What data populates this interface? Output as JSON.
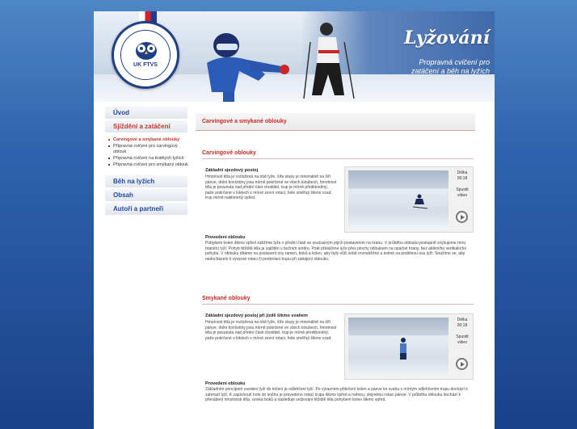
{
  "header": {
    "title": "Lyžování",
    "subtitle_line1": "Propravná cvičení pro",
    "subtitle_line2": "zatáčení a běh na lyžích",
    "logo_text": "UK FTVS"
  },
  "sidebar": {
    "items": [
      {
        "label": "Úvod"
      },
      {
        "label": "Sjíždění a zatáčení"
      },
      {
        "label": "Běh na lyžích"
      },
      {
        "label": "Obsah"
      },
      {
        "label": "Autoři a partneři"
      }
    ],
    "subitems": [
      {
        "label": "Carvingové a smykané oblouky"
      },
      {
        "label": "Přípravná cvičení pro carvingový oblouk"
      },
      {
        "label": "Přípravná cvičení na krátkých lyžích"
      },
      {
        "label": "Přípravná cvičení pro smýkaný oblouk"
      }
    ]
  },
  "main": {
    "heading": "Carvingové a smykané oblouky",
    "sections": [
      {
        "title": "Carvingové oblouky",
        "block1_title": "Základní sjezdový postoj",
        "block1_text": "Hmotnost těla je rozložená na obě lyže, šíře stopy je minimálně na šíři pánve, dolní končetiny jsou mírně pokrčené ve všech kloubech, hmotnost těla je posunuta nad přední část chodidel, trup je mírně předkloněný, paže pokrčené v loktech v mírné zevní rotaci, hole směřují šikmo vzad, trup mírně naklonený vpřed.",
        "block2_title": "Provedení oblouku",
        "block2_text": "Pohybem kolen šikmo vpřed zatížíme lyže v přední části se současným jejich postavením na hranu. V průběhu oblouku postupně zvyšujeme míru hranění lyží. Pohyb těžiště těla je zajištěn v bočním směru. Poté přetáčíme lyže přes plochy obloukem na opačné hrany, bez aktivního vertikálního pohybu. V oblouku dbáme na postavení osy ramen, boků a kolen, aby byly vůči sobě rovnoběžné a kolmé na podélnou osu lyží. Snažíme se, aby nedocházelo k výrazné rotaci či protirotaci trupu při zahájení oblouku.",
        "video_length_label": "Délka",
        "video_length": "00:18",
        "video_action": "Spustit video"
      },
      {
        "title": "Smykané oblouky",
        "block1_title": "Základní sjezdový postoj při jízdě šikmo svahem",
        "block1_text": "Hmotnost těla je rozložená na obě lyže, šíře stopy je minimálně na šíři pánve, dolní končetiny jsou mírně pokrčené ve všech kloubech, hmotnost těla je posunuta nad přední části chodidel, trup je mírně předkloněný, paže pokrčené v loktech v mírné zevní rotaci, hole směřují šikmo vzad.",
        "block2_title": "Provedení oblouku",
        "block2_text": "Základním principem uvedení lyží do točení je odlehčení lyží. Po výrazném přikrčení kolen a pánve ke svahu s mírným odlehčením trupu dochází k zahrnutí lyží. K zapíchnutí hole do sněhu je provedeno rotací trupu šikmo vpřed a nahoru, stejnému rotaci pánve. V průběhu oblouku dochází k přenášení hmotnosti těla, vzniká boků a následuje snižování těžiště těla pohybem kolen šikmo vpřed.",
        "video_length_label": "Délka",
        "video_length": "00:18",
        "video_action": "Spustit video"
      }
    ]
  }
}
